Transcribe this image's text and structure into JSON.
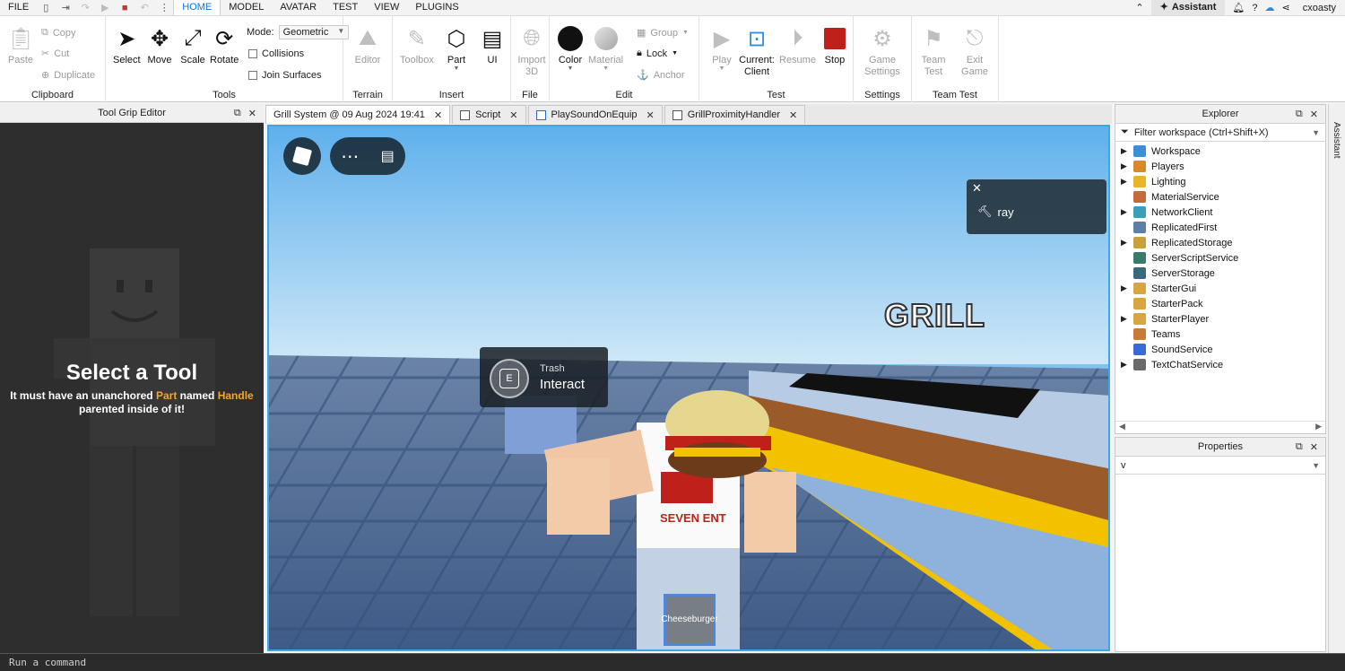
{
  "menubar": {
    "file": "FILE",
    "tabs": [
      "HOME",
      "MODEL",
      "AVATAR",
      "TEST",
      "VIEW",
      "PLUGINS"
    ],
    "assistant": "Assistant",
    "username": "cxoasty"
  },
  "ribbon": {
    "clipboard": {
      "paste": "Paste",
      "copy": "Copy",
      "cut": "Cut",
      "duplicate": "Duplicate",
      "label": "Clipboard"
    },
    "tools": {
      "select": "Select",
      "move": "Move",
      "scale": "Scale",
      "rotate": "Rotate",
      "mode_label": "Mode:",
      "mode_value": "Geometric",
      "collisions": "Collisions",
      "join_surfaces": "Join Surfaces",
      "label": "Tools"
    },
    "terrain": {
      "editor": "Editor",
      "label": "Terrain"
    },
    "insert": {
      "toolbox": "Toolbox",
      "part": "Part",
      "ui": "UI",
      "label": "Insert"
    },
    "file": {
      "import3d": "Import 3D",
      "label": "File"
    },
    "edit": {
      "color": "Color",
      "material": "Material",
      "group": "Group",
      "lock": "Lock",
      "anchor": "Anchor",
      "label": "Edit"
    },
    "test": {
      "play": "Play",
      "current_client": "Current: Client",
      "resume": "Resume",
      "stop": "Stop",
      "label": "Test"
    },
    "settings": {
      "game_settings": "Game Settings",
      "label": "Settings"
    },
    "team_test": {
      "team_test": "Team Test",
      "exit_game": "Exit Game",
      "label": "Team Test"
    }
  },
  "left_panel": {
    "title": "Tool Grip Editor",
    "heading": "Select a Tool",
    "line1_a": "It must have an unanchored",
    "line1_part": "Part",
    "line1_b": "named",
    "line1_handle": "Handle",
    "line2": "parented inside of it!"
  },
  "tabs": [
    {
      "label": "Grill System @ 09 Aug 2024 19:41"
    },
    {
      "label": "Script"
    },
    {
      "label": "PlaySoundOnEquip"
    },
    {
      "label": "GrillProximityHandler"
    }
  ],
  "viewport": {
    "toast_text": "ray",
    "prompt_key": "E",
    "prompt_object": "Trash",
    "prompt_action": "Interact",
    "sign_text": "GRILL",
    "hotbar_item": "Cheeseburger"
  },
  "explorer": {
    "title": "Explorer",
    "filter_placeholder": "Filter workspace (Ctrl+Shift+X)",
    "items": [
      {
        "label": "Workspace",
        "expandable": true,
        "color": "#3a8fd8"
      },
      {
        "label": "Players",
        "expandable": true,
        "color": "#d88a2a"
      },
      {
        "label": "Lighting",
        "expandable": true,
        "color": "#e8b52a"
      },
      {
        "label": "MaterialService",
        "expandable": false,
        "color": "#c66a3a"
      },
      {
        "label": "NetworkClient",
        "expandable": true,
        "color": "#3a9fb8"
      },
      {
        "label": "ReplicatedFirst",
        "expandable": false,
        "color": "#5a7fa8"
      },
      {
        "label": "ReplicatedStorage",
        "expandable": true,
        "color": "#c9a040"
      },
      {
        "label": "ServerScriptService",
        "expandable": false,
        "color": "#3a7a6a"
      },
      {
        "label": "ServerStorage",
        "expandable": false,
        "color": "#3a6a7a"
      },
      {
        "label": "StarterGui",
        "expandable": true,
        "color": "#d8a640"
      },
      {
        "label": "StarterPack",
        "expandable": false,
        "color": "#d8a640"
      },
      {
        "label": "StarterPlayer",
        "expandable": true,
        "color": "#d8a640"
      },
      {
        "label": "Teams",
        "expandable": false,
        "color": "#c87a3a"
      },
      {
        "label": "SoundService",
        "expandable": false,
        "color": "#3a6ad8"
      },
      {
        "label": "TextChatService",
        "expandable": true,
        "color": "#6a6a6a"
      }
    ]
  },
  "properties": {
    "title": "Properties",
    "filter_value": "v"
  },
  "sidetab": {
    "label": "Assistant"
  },
  "command_bar": {
    "placeholder": "Run a command"
  }
}
